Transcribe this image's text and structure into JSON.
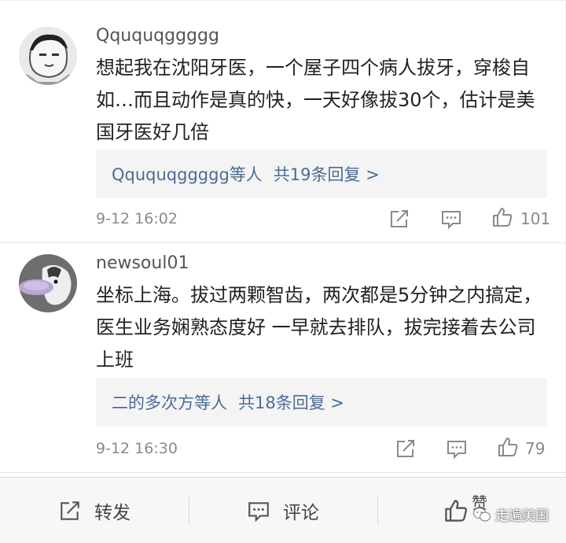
{
  "comments": [
    {
      "username": "Qququqggggg",
      "text": "想起我在沈阳牙医，一个屋子四个病人拔牙，穿梭自如…而且动作是真的快，一天好像拔30个，估计是美国牙医好几倍",
      "reply_users": "Qququqggggg等人",
      "reply_count": "共19条回复 >",
      "timestamp": "9-12 16:02",
      "likes": "101"
    },
    {
      "username": "newsoul01",
      "text": "坐标上海。拔过两颗智齿，两次都是5分钟之内搞定，医生业务娴熟态度好 一早就去排队，拔完接着去公司上班",
      "reply_users": "二的多次方等人",
      "reply_count": "共18条回复 >",
      "timestamp": "9-12 16:30",
      "likes": "79"
    }
  ],
  "bottom_bar": {
    "repost_label": "转发",
    "comment_label": "评论",
    "like_label": "赞"
  },
  "watermark": "走遍美国",
  "icons": {
    "repost": "repost-icon",
    "comment": "comment-icon",
    "like": "thumbs-up-icon",
    "wechat": "wechat-icon"
  },
  "colors": {
    "link": "#4a6c95",
    "meta": "#8a8a8a",
    "reply_bg": "#f4f4f4"
  }
}
